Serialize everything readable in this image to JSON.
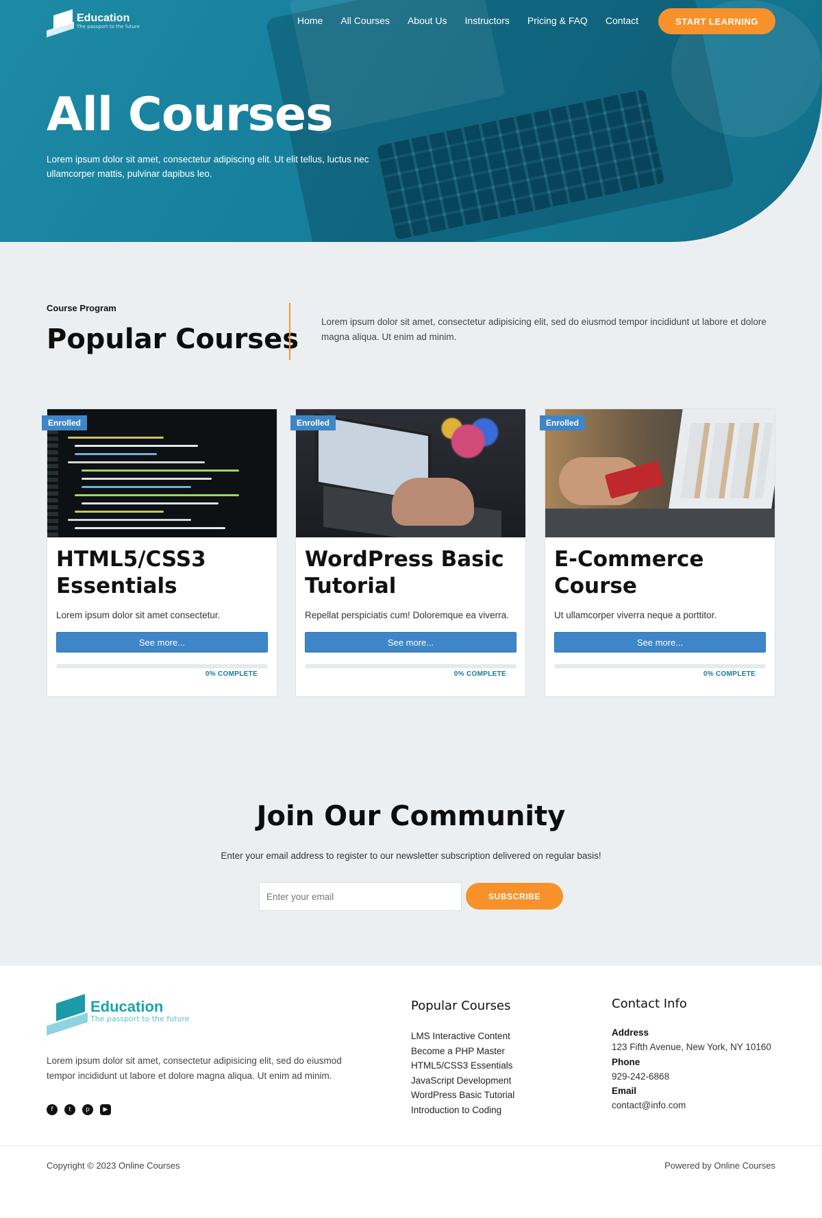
{
  "header": {
    "logo_title": "Education",
    "logo_tagline": "The passport to the future",
    "nav": [
      "Home",
      "All Courses",
      "About Us",
      "Instructors",
      "Pricing & FAQ",
      "Contact"
    ],
    "cta_label": "START LEARNING"
  },
  "hero": {
    "title": "All Courses",
    "subtitle": "Lorem ipsum dolor sit amet, consectetur adipiscing elit. Ut elit tellus, luctus nec ullamcorper mattis, pulvinar dapibus leo."
  },
  "popular": {
    "label": "Course Program",
    "title": "Popular Courses",
    "description": "Lorem ipsum dolor sit amet, consectetur adipisicing elit, sed do eiusmod tempor incididunt ut labore et dolore magna aliqua. Ut enim ad minim."
  },
  "courses": [
    {
      "badge": "Enrolled",
      "title": "HTML5/CSS3 Essentials",
      "excerpt": "Lorem ipsum dolor sit amet consectetur.",
      "button": "See more...",
      "progress": 0,
      "progress_label": "0% COMPLETE"
    },
    {
      "badge": "Enrolled",
      "title": "WordPress Basic Tutorial",
      "excerpt": "Repellat perspiciatis cum! Doloremque ea viverra.",
      "button": "See more...",
      "progress": 0,
      "progress_label": "0% COMPLETE"
    },
    {
      "badge": "Enrolled",
      "title": "E-Commerce Course",
      "excerpt": "Ut ullamcorper viverra neque a porttitor.",
      "button": "See more...",
      "progress": 0,
      "progress_label": "0% COMPLETE"
    }
  ],
  "community": {
    "title": "Join Our Community",
    "description": "Enter your email address to register to our newsletter subscription delivered on regular basis!",
    "email_placeholder": "Enter your email",
    "subscribe_label": "SUBSCRIBE"
  },
  "footer": {
    "logo_title": "Education",
    "logo_tagline": "The passport to the future",
    "description": "Lorem ipsum dolor sit amet, consectetur adipisicing elit, sed do eiusmod tempor incididunt ut labore et dolore magna aliqua. Ut enim ad minim.",
    "socials": [
      "facebook-icon",
      "twitter-icon",
      "pinterest-icon",
      "youtube-icon"
    ],
    "popular_heading": "Popular Courses",
    "popular_links": [
      "LMS Interactive Content",
      "Become a PHP Master",
      "HTML5/CSS3 Essentials",
      "JavaScript Development",
      "WordPress Basic Tutorial",
      "Introduction to Coding"
    ],
    "contact_heading": "Contact Info",
    "address_label": "Address",
    "address": "123 Fifth Avenue, New York, NY 10160",
    "phone_label": "Phone",
    "phone": "929-242-6868",
    "email_label": "Email",
    "email": "contact@info.com",
    "copyright": "Copyright © 2023 Online Courses",
    "powered": "Powered by Online Courses"
  },
  "colors": {
    "hero_teal": "#167f9b",
    "accent_orange": "#f7922b",
    "button_blue": "#3e86c7",
    "background": "#eceff2"
  }
}
